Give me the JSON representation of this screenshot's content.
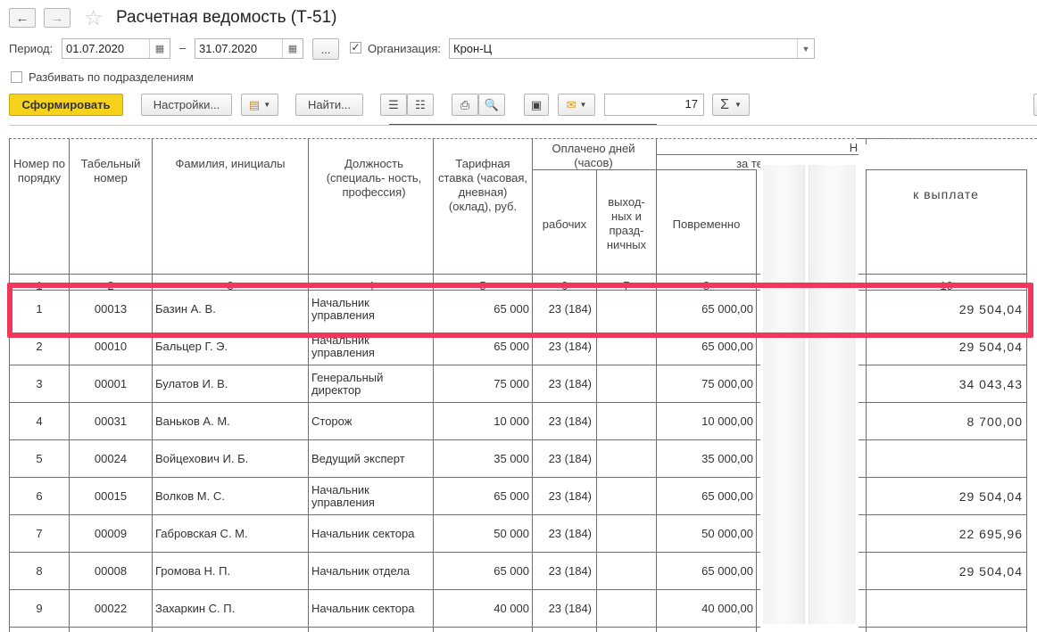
{
  "window": {
    "title": "Расчетная ведомость (Т-51)"
  },
  "toolbar": {
    "period_label": "Период:",
    "date_from": "01.07.2020",
    "date_dash": "–",
    "date_to": "31.07.2020",
    "ellipsis_label": "...",
    "org_label": "Организация:",
    "org_value": "Крон-Ц",
    "split_label": "Разбивать по подразделениям",
    "form_button": "Сформировать",
    "settings_button": "Настройки...",
    "find_button": "Найти...",
    "counter_value": "17",
    "sigma": "Σ"
  },
  "table": {
    "headers": {
      "num": "Номер по порядку",
      "tab": "Табельный номер",
      "name": "Фамилия, инициалы",
      "position": "Должность (специаль- ность, профессия)",
      "rate": "Тарифная ставка (часовая, дневная) (оклад), руб.",
      "paid_group": "Оплачено дней (часов)",
      "work": "рабочих",
      "holiday": "выход- ных и празд- ничных",
      "group_fragment": "На",
      "sub_fragment": "за те",
      "time": "Повременно",
      "payout": "к выплате"
    },
    "col_numbers": [
      "1",
      "2",
      "3",
      "4",
      "5",
      "6",
      "7",
      "8",
      "10"
    ],
    "rows": [
      {
        "n": "1",
        "tab": "00013",
        "name": "Базин А. В.",
        "pos": "Начальник управления",
        "rate": "65 000",
        "days": "23 (184)",
        "time": "65 000,00",
        "pay": "29 504,04"
      },
      {
        "n": "2",
        "tab": "00010",
        "name": "Бальцер Г. Э.",
        "pos": "Начальник управления",
        "rate": "65 000",
        "days": "23 (184)",
        "time": "65 000,00",
        "pay": "29 504,04"
      },
      {
        "n": "3",
        "tab": "00001",
        "name": "Булатов И. В.",
        "pos": "Генеральный директор",
        "rate": "75 000",
        "days": "23 (184)",
        "time": "75 000,00",
        "pay": "34 043,43"
      },
      {
        "n": "4",
        "tab": "00031",
        "name": "Ваньков А. М.",
        "pos": "Сторож",
        "rate": "10 000",
        "days": "23 (184)",
        "time": "10 000,00",
        "pay": "8 700,00"
      },
      {
        "n": "5",
        "tab": "00024",
        "name": "Войцехович И. Б.",
        "pos": "Ведущий эксперт",
        "rate": "35 000",
        "days": "23 (184)",
        "time": "35 000,00",
        "pay": ""
      },
      {
        "n": "6",
        "tab": "00015",
        "name": "Волков М. С.",
        "pos": "Начальник управления",
        "rate": "65 000",
        "days": "23 (184)",
        "time": "65 000,00",
        "pay": "29 504,04"
      },
      {
        "n": "7",
        "tab": "00009",
        "name": "Габровская С. М.",
        "pos": "Начальник сектора",
        "rate": "50 000",
        "days": "23 (184)",
        "time": "50 000,00",
        "pay": "22 695,96"
      },
      {
        "n": "8",
        "tab": "00008",
        "name": "Громова Н. П.",
        "pos": "Начальник отдела",
        "rate": "65 000",
        "days": "23 (184)",
        "time": "65 000,00",
        "pay": "29 504,04"
      },
      {
        "n": "9",
        "tab": "00022",
        "name": "Захаркин С. П.",
        "pos": "Начальник сектора",
        "rate": "40 000",
        "days": "23 (184)",
        "time": "40 000,00",
        "pay": ""
      }
    ]
  },
  "colors": {
    "highlight": "#f0385c",
    "primary_button": "#f6d21d"
  }
}
